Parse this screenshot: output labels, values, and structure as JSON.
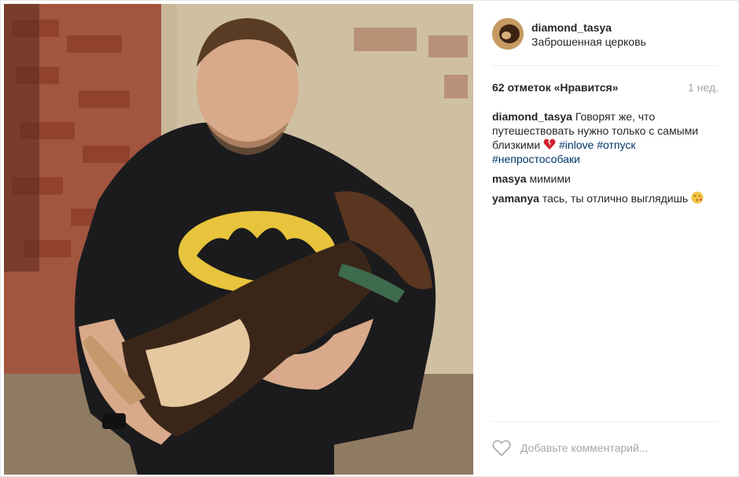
{
  "post": {
    "username": "diamond_tasya",
    "location": "Заброшенная церковь",
    "likes_text": "62 отметок «Нравится»",
    "time_ago": "1 нед.",
    "caption": {
      "user": "diamond_tasya",
      "text": " Говорят же, что путешествовать нужно только с самыми близкими ",
      "emoji": "broken-heart-icon",
      "tags": [
        "#inlove",
        "#отпуск",
        "#непростособаки"
      ]
    },
    "comments": [
      {
        "user": "masya",
        "text": " мимими"
      },
      {
        "user": "yamanya",
        "text": " тась, ты отлично выглядишь ",
        "emoji": "kiss-face-icon"
      }
    ],
    "comment_placeholder": "Добавьте комментарий...",
    "colors": {
      "link": "#003569",
      "muted": "#a5a7aa",
      "border": "#efefef"
    }
  }
}
